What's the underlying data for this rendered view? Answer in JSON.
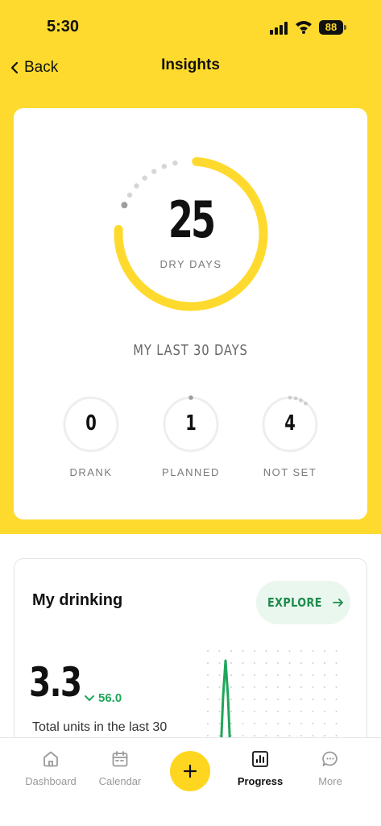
{
  "status_bar": {
    "time": "5:30",
    "battery": "88"
  },
  "nav": {
    "back_label": "Back",
    "title": "Insights"
  },
  "summary": {
    "value": "25",
    "value_label": "DRY DAYS",
    "fraction": 0.833,
    "period_label": "MY LAST 30 DAYS",
    "stats": [
      {
        "value": "0",
        "label": "DRANK"
      },
      {
        "value": "1",
        "label": "PLANNED"
      },
      {
        "value": "4",
        "label": "NOT SET"
      }
    ]
  },
  "drinking": {
    "title": "My drinking",
    "explore_label": "EXPLORE",
    "total": "3.3",
    "delta": "56.0",
    "caption": "Total units in the last 30"
  },
  "tabs": [
    {
      "label": "Dashboard",
      "icon": "home-icon"
    },
    {
      "label": "Calendar",
      "icon": "calendar-icon"
    },
    {
      "label": "",
      "icon": "plus-icon"
    },
    {
      "label": "Progress",
      "icon": "bar-chart-icon"
    },
    {
      "label": "More",
      "icon": "chat-bubble-icon"
    }
  ],
  "colors": {
    "accent": "#FFDA2E",
    "green": "#1FA65A",
    "grey": "#BDBDBD"
  }
}
